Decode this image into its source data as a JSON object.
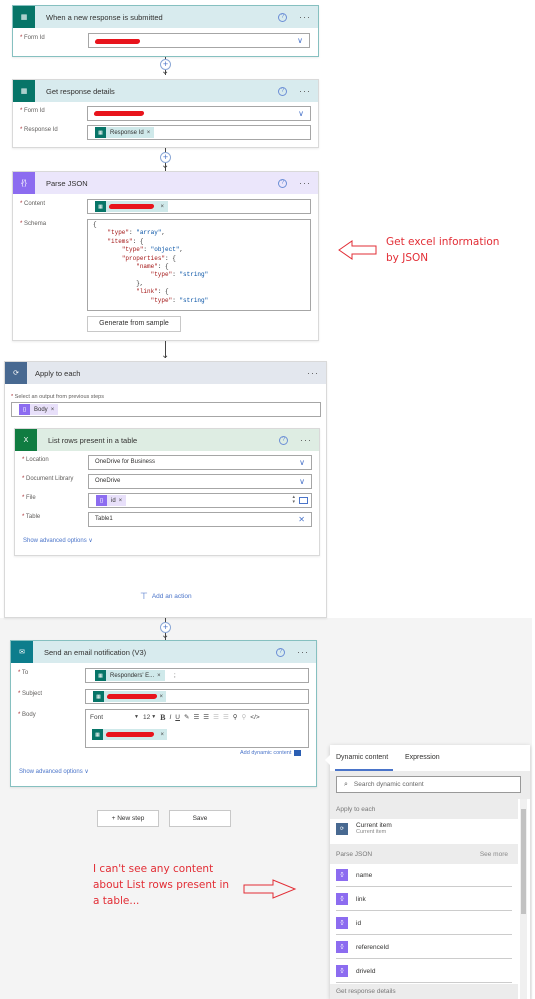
{
  "cards": {
    "trigger": {
      "title": "When a new response is submitted",
      "fields": [
        {
          "label": "Form Id"
        }
      ]
    },
    "get_response": {
      "title": "Get response details",
      "fields": [
        {
          "label": "Form Id"
        },
        {
          "label": "Response Id",
          "token": "Response Id"
        }
      ]
    },
    "parse_json": {
      "title": "Parse JSON",
      "content_label": "Content",
      "schema_label": "Schema",
      "schema_lines": [
        "{",
        "    \"type\": \"array\",",
        "    \"items\": {",
        "        \"type\": \"object\",",
        "        \"properties\": {",
        "            \"name\": {",
        "                \"type\": \"string\"",
        "            },",
        "            \"link\": {",
        "                \"type\": \"string\""
      ],
      "generate_button": "Generate from sample"
    },
    "apply_each": {
      "title": "Apply to each",
      "select_label": "Select an output from previous steps",
      "token": "Body",
      "add_action": "Add an action"
    },
    "list_rows": {
      "title": "List rows present in a table",
      "fields": [
        {
          "label": "Location",
          "value": "OneDrive for Business"
        },
        {
          "label": "Document Library",
          "value": "OneDrive"
        },
        {
          "label": "File",
          "token": "id"
        },
        {
          "label": "Table",
          "value": "Table1"
        }
      ],
      "advanced": "Show advanced options"
    },
    "email": {
      "title": "Send an email notification (V3)",
      "fields": [
        {
          "label": "To",
          "token": "Responders' E...",
          "suffix": ";"
        },
        {
          "label": "Subject"
        },
        {
          "label": "Body"
        }
      ],
      "toolbar": {
        "font": "Font",
        "size": "12",
        "bold": "B",
        "italic": "I",
        "underline": "U",
        "code": "</>"
      },
      "add_dynamic": "Add dynamic content",
      "advanced": "Show advanced options"
    }
  },
  "buttons": {
    "new_step": "+ New step",
    "save": "Save"
  },
  "annotations": {
    "json": [
      "Get excel information",
      "by JSON"
    ],
    "list_rows": [
      "I can't see any content",
      "about List rows present in",
      "a table..."
    ]
  },
  "dynamic_panel": {
    "tabs": [
      "Dynamic content",
      "Expression"
    ],
    "search_placeholder": "Search dynamic content",
    "sections": [
      {
        "title": "Apply to each"
      },
      {
        "title": "Parse JSON",
        "action": "See more"
      },
      {
        "title": "Get response details"
      }
    ],
    "current_item": {
      "label": "Current item",
      "sub": "Current item"
    },
    "parse_items": [
      "name",
      "link",
      "id",
      "referenceId",
      "driveId"
    ]
  },
  "colors": {
    "forms": "#077568",
    "json": "#8c6cf0",
    "loop": "#486991",
    "excel": "#107c41",
    "mail": "#0d7d8c",
    "annotation": "#e22d35",
    "link": "#4a74c9"
  }
}
